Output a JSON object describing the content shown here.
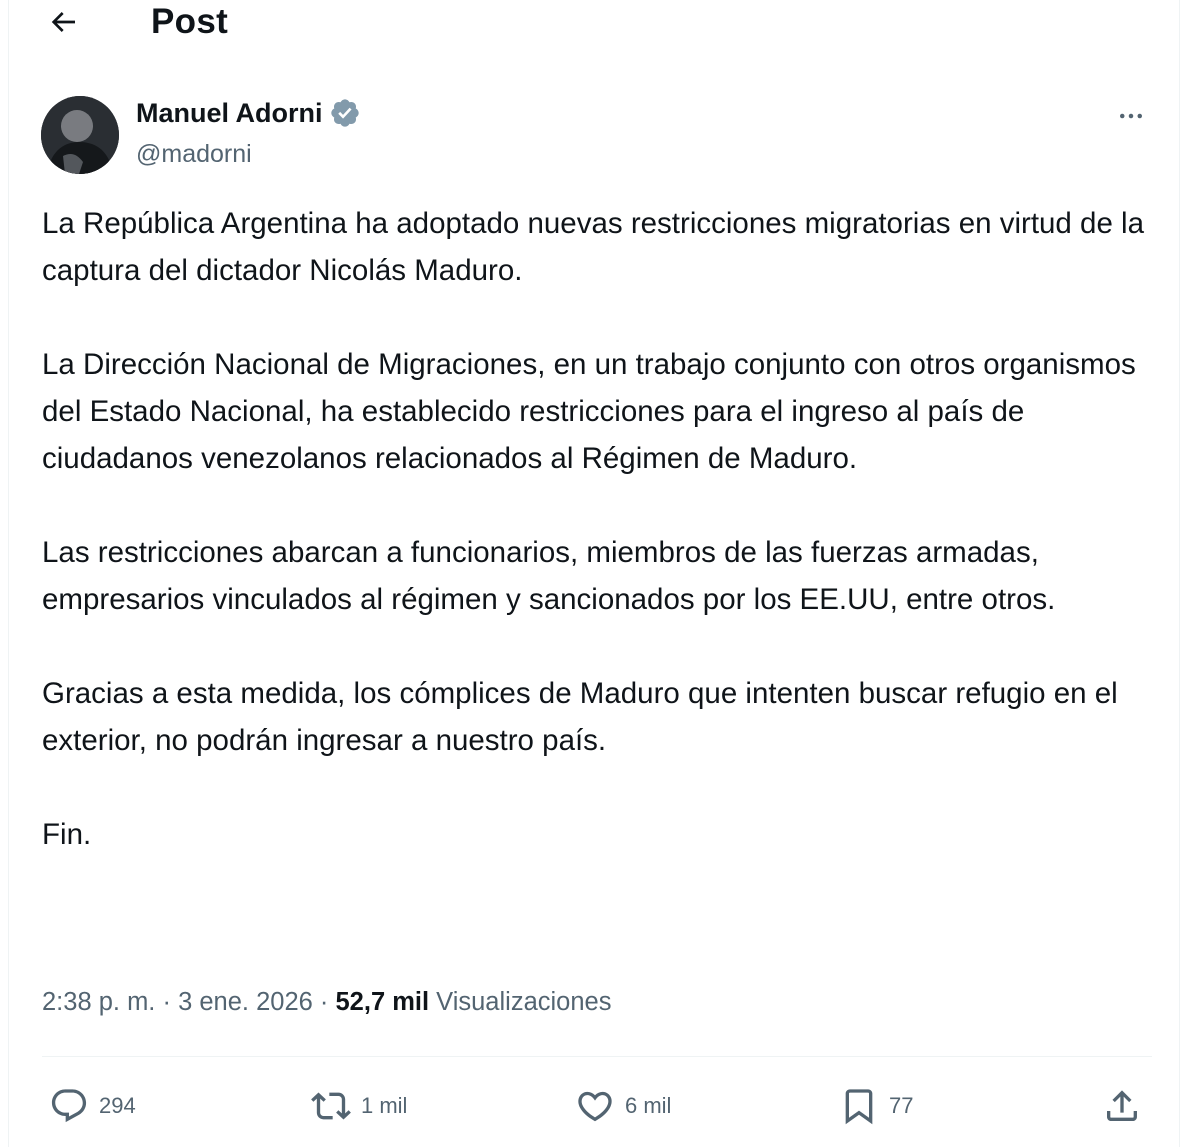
{
  "header": {
    "title": "Post"
  },
  "author": {
    "name": "Manuel Adorni",
    "handle": "@madorni"
  },
  "post": {
    "paragraphs": [
      "La República Argentina ha adoptado nuevas restricciones migratorias en virtud de la captura del dictador Nicolás Maduro.",
      "La Dirección Nacional de Migraciones, en un trabajo conjunto con otros organismos del Estado Nacional, ha establecido restricciones para el ingreso al país de ciudadanos venezolanos relacionados al Régimen de Maduro.",
      "Las restricciones abarcan a funcionarios, miembros de las fuerzas armadas, empresarios vinculados al régimen y sancionados por los EE.UU, entre otros.",
      "Gracias a esta medida, los cómplices de Maduro que intenten buscar refugio en el exterior, no podrán ingresar a nuestro país.",
      "Fin."
    ]
  },
  "meta": {
    "time": "2:38 p. m.",
    "separator": "·",
    "date": "3 ene. 2026",
    "views_count": "52,7 mil",
    "views_label": "Visualizaciones"
  },
  "actions": {
    "replies": "294",
    "reposts": "1 mil",
    "likes": "6 mil",
    "bookmarks": "77"
  },
  "icons": {
    "back": "arrow-left-icon",
    "verified": "verified-badge-icon",
    "more": "more-horizontal-icon",
    "reply": "reply-icon",
    "repost": "repost-icon",
    "like": "heart-icon",
    "bookmark": "bookmark-icon",
    "share": "share-icon"
  },
  "colors": {
    "text": "#0f1419",
    "secondary": "#536471",
    "verified": "#829aab",
    "divider": "#eff3f4"
  }
}
